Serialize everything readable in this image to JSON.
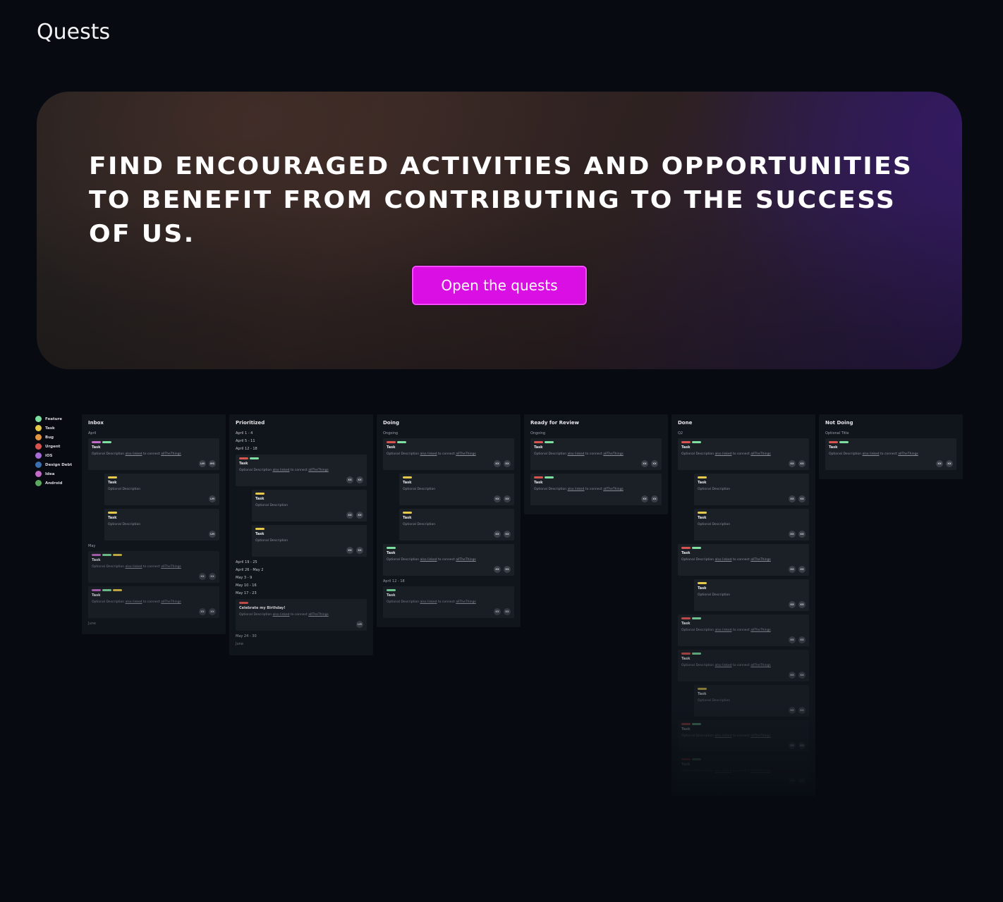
{
  "page": {
    "title": "Quests"
  },
  "hero": {
    "headline": "FIND ENCOURAGED ACTIVITIES AND OPPORTUNITIES TO BENEFIT FROM CONTRIBUTING TO THE SUCCESS OF US.",
    "cta_label": "Open the quests",
    "cta_color": "#d90fe4"
  },
  "legend": [
    {
      "label": "Feature",
      "color": "#7ee0a0"
    },
    {
      "label": "Task",
      "color": "#e6c94a"
    },
    {
      "label": "Bug",
      "color": "#e39440"
    },
    {
      "label": "Urgent",
      "color": "#d9534f"
    },
    {
      "label": "iOS",
      "color": "#a56bd6"
    },
    {
      "label": "Design Debt",
      "color": "#3b6fb0"
    },
    {
      "label": "Idea",
      "color": "#c46ac7"
    },
    {
      "label": "Android",
      "color": "#5ba860"
    }
  ],
  "columns": {
    "inbox": {
      "title": "Inbox",
      "april": "April",
      "may": "May",
      "june": "June",
      "card_title": "Task",
      "desc_full_pre": "Optional Description ",
      "desc_link1": "also linked",
      "desc_mid": " to connect ",
      "desc_link2": "allTheThings",
      "desc_short": "Optional Description",
      "av_lm": "LM",
      "av_ms": "MS",
      "av_xx": "XX"
    },
    "prioritized": {
      "title": "Prioritized",
      "r1": "April 1 - 4",
      "r2": "April 5 - 11",
      "r3": "April 12 - 18",
      "r4": "April 19 - 25",
      "r5": "April 26 - May 2",
      "r6": "May 3 - 9",
      "r7": "May 10 - 16",
      "r8": "May 17 - 23",
      "r9": "May 24 - 30",
      "june": "June",
      "birthday": "Celebrate my Birthday!"
    },
    "doing": {
      "title": "Doing",
      "ongoing": "Ongoing",
      "april_range": "April 12 - 18"
    },
    "review": {
      "title": "Ready for Review",
      "ongoing": "Ongoing"
    },
    "done": {
      "title": "Done",
      "q2": "Q2"
    },
    "not_doing": {
      "title": "Not Doing",
      "optional_title": "Optional Title"
    }
  }
}
